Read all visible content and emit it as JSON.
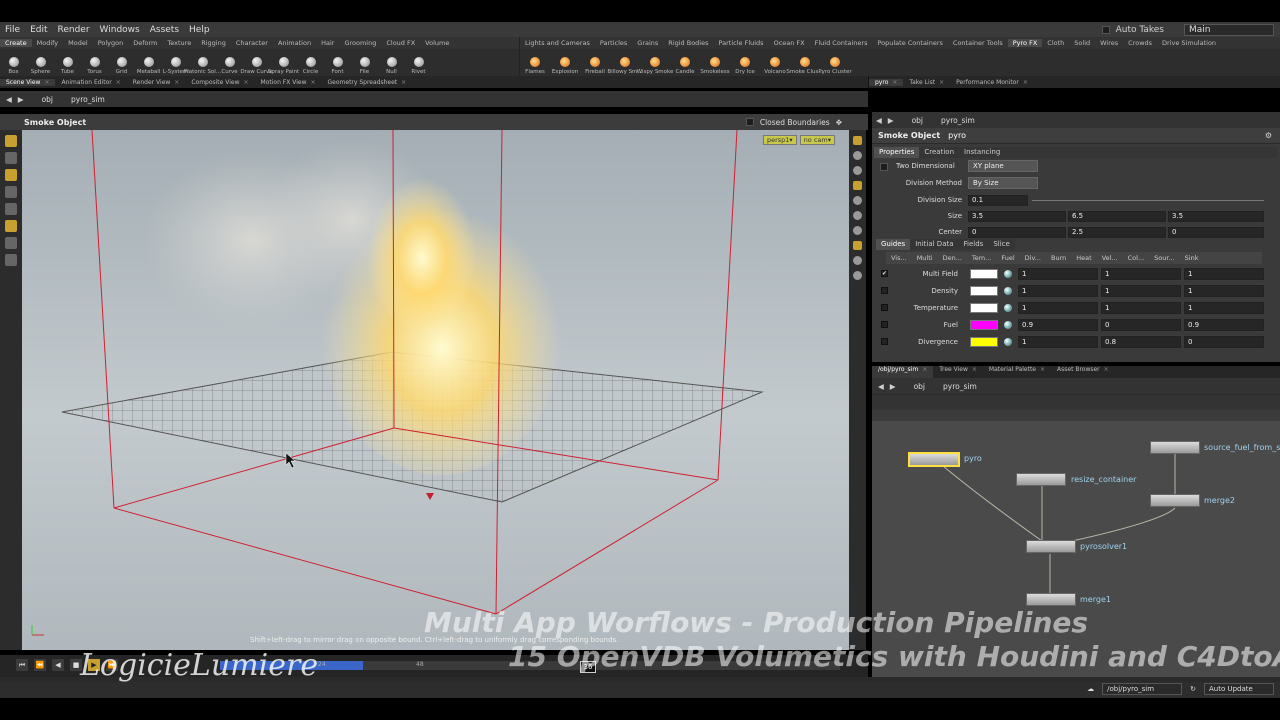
{
  "menu": [
    "File",
    "Edit",
    "Render",
    "Windows",
    "Assets",
    "Help"
  ],
  "auto_takes": "Auto Takes",
  "workspace": "Main",
  "shelf_tabs_left": [
    "Create",
    "Modify",
    "Model",
    "Polygon",
    "Deform",
    "Texture",
    "Rigging",
    "Character",
    "Animation",
    "Hair",
    "Grooming",
    "Cloud FX",
    "Volume"
  ],
  "shelf_tabs_right": [
    "Lights and Cameras",
    "Particles",
    "Grains",
    "Rigid Bodies",
    "Particle Fluids",
    "Ocean FX",
    "Fluid Containers",
    "Populate Containers",
    "Container Tools",
    "Pyro FX",
    "Cloth",
    "Solid",
    "Wires",
    "Crowds",
    "Drive Simulation"
  ],
  "tools_left": [
    "Box",
    "Sphere",
    "Tube",
    "Torus",
    "Grid",
    "Metaball",
    "L-System",
    "Platonic Sol...",
    "Curve",
    "Draw Curve",
    "Spray Paint",
    "Circle",
    "Font",
    "File",
    "Null",
    "Rivet"
  ],
  "tools_right": [
    "Flames",
    "Explosion",
    "Fireball",
    "Billowy Sm...",
    "Wispy Smoke",
    "Candle",
    "Smokeless",
    "Dry Ice",
    "Volcano",
    "Smoke Clus...",
    "Pyro Cluster"
  ],
  "panel_tabs_left": [
    "Scene View",
    "Animation Editor",
    "Render View",
    "Composite View",
    "Motion FX View",
    "Geometry Spreadsheet"
  ],
  "panel_tabs_right": [
    "pyro",
    "Take List",
    "Performance Monitor"
  ],
  "viewer_path": [
    "obj",
    "pyro_sim"
  ],
  "viewport": {
    "title": "Smoke Object",
    "closed_boundaries": "Closed Boundaries",
    "cam_persp": "persp1▾",
    "cam_nocam": "no cam▾",
    "hint": "Shift+left-drag to mirror drag on opposite bound. Ctrl+left-drag to uniformly drag corresponding bounds."
  },
  "timeline": {
    "frame": "36",
    "ticks": [
      "24",
      "48"
    ],
    "progress": 0.23
  },
  "params": {
    "node_type": "Smoke Object",
    "node_name": "pyro",
    "tabs": [
      "Properties",
      "Creation",
      "Instancing"
    ],
    "two_dimensional": "Two Dimensional",
    "plane": "XY plane",
    "division_method_label": "Division Method",
    "division_method": "By Size",
    "division_size_label": "Division Size",
    "division_size": "0.1",
    "size_label": "Size",
    "size": [
      "3.5",
      "6.5",
      "3.5"
    ],
    "center_label": "Center",
    "center": [
      "0",
      "2.5",
      "0"
    ],
    "subtabs": [
      "Guides",
      "Initial Data",
      "Fields",
      "Slice"
    ],
    "guide_headers": [
      "Vis...",
      "Multi",
      "Den...",
      "Tem...",
      "Fuel",
      "Div...",
      "Burn",
      "Heat",
      "Vel...",
      "Col...",
      "Sour...",
      "Sink"
    ],
    "guides": [
      {
        "checked": "✔",
        "name": "Multi Field",
        "color": "#ffffff",
        "v": [
          "1",
          "1",
          "1"
        ]
      },
      {
        "checked": "",
        "name": "Density",
        "color": "#ffffff",
        "v": [
          "1",
          "1",
          "1"
        ]
      },
      {
        "checked": "",
        "name": "Temperature",
        "color": "#ffffff",
        "v": [
          "1",
          "1",
          "1"
        ]
      },
      {
        "checked": "",
        "name": "Fuel",
        "color": "#ff00ff",
        "v": [
          "0.9",
          "0",
          "0.9"
        ]
      },
      {
        "checked": "",
        "name": "Divergence",
        "color": "#ffff00",
        "v": [
          "1",
          "0.8",
          "0"
        ]
      }
    ]
  },
  "network": {
    "tabs": [
      "/obj/pyro_sim",
      "Tree View",
      "Material Palette",
      "Asset Browser"
    ],
    "path": [
      "obj",
      "pyro_sim"
    ],
    "nodes": [
      "pyro",
      "source_fuel_from_s",
      "resize_container",
      "merge2",
      "pyrosolver1",
      "merge1"
    ]
  },
  "status": {
    "path": "/obj/pyro_sim",
    "auto_update": "Auto Update"
  },
  "overlay": {
    "title1": "Multi App Worflows - Production Pipelines",
    "title2": "15 OpenVDB Volumetics with Houdini and C4DtoA",
    "logo": "LogicieLumiere"
  }
}
